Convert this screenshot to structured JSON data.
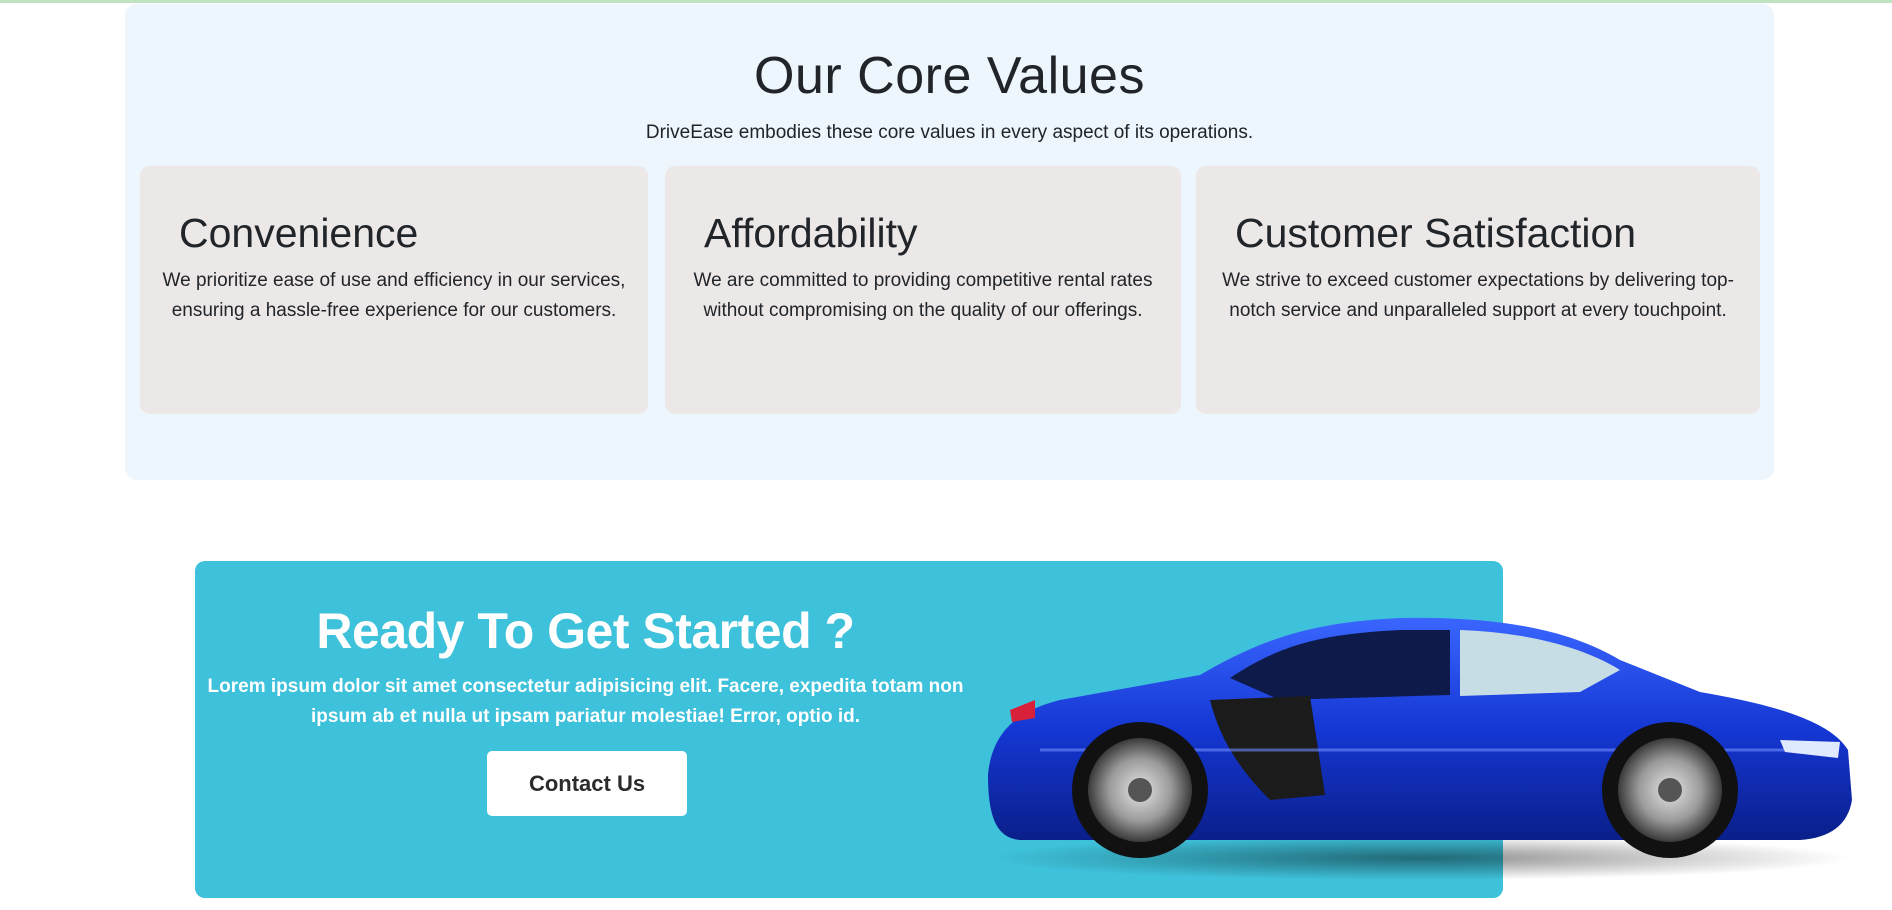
{
  "values": {
    "title": "Our Core Values",
    "subtitle": "DriveEase embodies these core values in every aspect of its operations.",
    "cards": [
      {
        "title": "Convenience",
        "text": "We prioritize ease of use and efficiency in our services, ensuring a hassle-free experience for our customers."
      },
      {
        "title": "Affordability",
        "text": "We are committed to providing competitive rental rates without compromising on the quality of our offerings."
      },
      {
        "title": "Customer Satisfaction",
        "text": "We strive to exceed customer expectations by delivering top-notch service and unparalleled support at every touchpoint."
      }
    ]
  },
  "cta": {
    "title": "Ready To Get Started ?",
    "text": "Lorem ipsum dolor sit amet consectetur adipisicing elit. Facere, expedita totam non ipsum ab et nulla ut ipsam pariatur molestiae! Error, optio id.",
    "button_label": "Contact Us"
  },
  "colors": {
    "section_bg": "#eef6fd",
    "card_bg": "#ede8e8",
    "cta_bg": "#3ec1da",
    "car_body": "#1a3fd6"
  },
  "icons": {
    "car": "car-image"
  }
}
